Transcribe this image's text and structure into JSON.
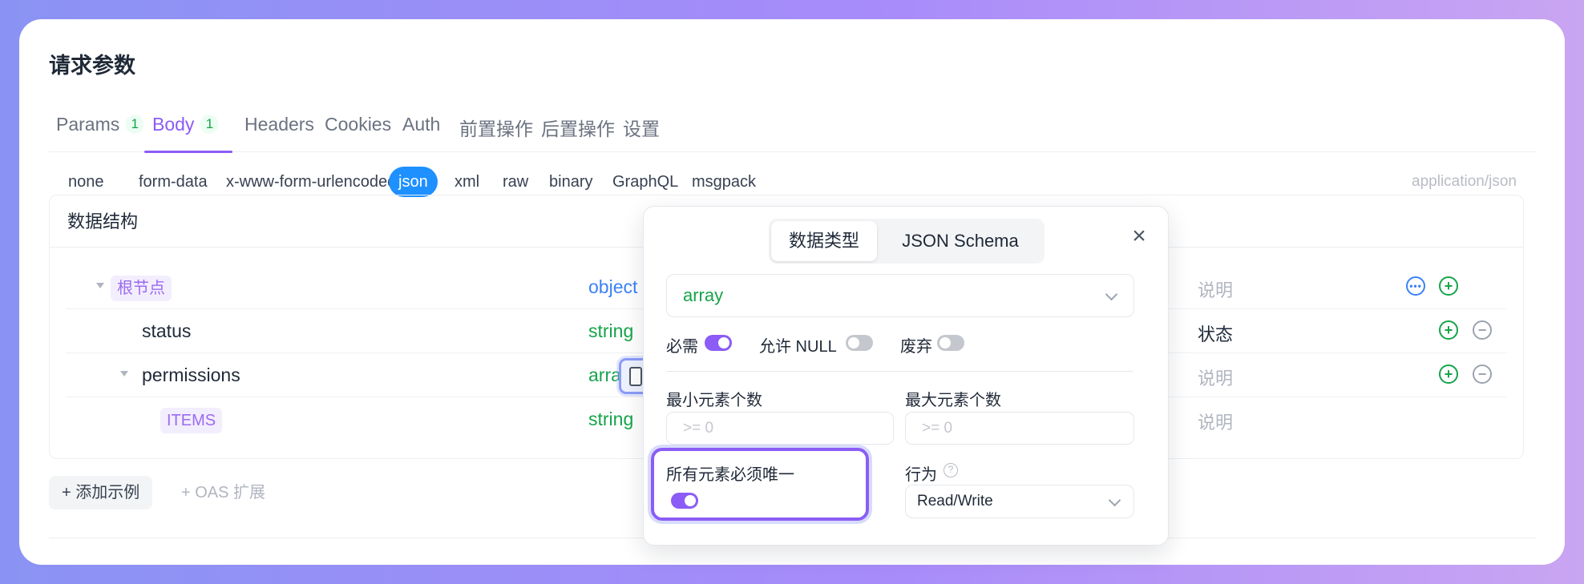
{
  "section_title": "请求参数",
  "tabs": [
    {
      "label": "Params",
      "badge": "1"
    },
    {
      "label": "Body",
      "badge": "1"
    },
    {
      "label": "Headers"
    },
    {
      "label": "Cookies"
    },
    {
      "label": "Auth"
    },
    {
      "label": "前置操作"
    },
    {
      "label": "后置操作"
    },
    {
      "label": "设置"
    }
  ],
  "body_types": [
    "none",
    "form-data",
    "x-www-form-urlencoded",
    "json",
    "xml",
    "raw",
    "binary",
    "GraphQL",
    "msgpack"
  ],
  "content_type": "application/json",
  "struct": {
    "title": "数据结构",
    "rows": [
      {
        "name": "根节点",
        "type": "object",
        "desc": "说明"
      },
      {
        "name": "status",
        "type": "string",
        "desc": "状态"
      },
      {
        "name": "permissions",
        "type": "array",
        "desc": "说明"
      },
      {
        "name": "ITEMS",
        "type": "string",
        "desc": "说明"
      }
    ]
  },
  "actions": {
    "add_example": "+ 添加示例",
    "oas_extension": "+ OAS 扩展"
  },
  "popover": {
    "seg_tabs": [
      "数据类型",
      "JSON Schema"
    ],
    "type_value": "array",
    "toggles": [
      {
        "label": "必需",
        "on": true
      },
      {
        "label": "允许 NULL",
        "on": false
      },
      {
        "label": "废弃",
        "on": false
      }
    ],
    "min_items_label": "最小元素个数",
    "max_items_label": "最大元素个数",
    "min_placeholder": ">= 0",
    "max_placeholder": ">= 0",
    "unique_label": "所有元素必须唯一",
    "unique_on": true,
    "behavior_label": "行为",
    "behavior_value": "Read/Write"
  },
  "colors": {
    "accent": "#8b5cf6",
    "json_active": "#1e90ff",
    "string_type": "#16a34a",
    "object_type": "#3b82f6"
  }
}
